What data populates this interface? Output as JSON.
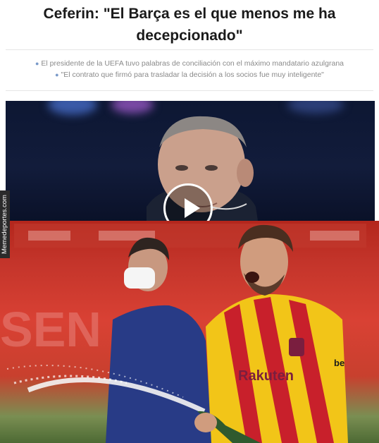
{
  "article": {
    "headline": "Ceferin: \"El Barça es el que menos me ha decepcionado\"",
    "bullets": [
      "El presidente de la UEFA tuvo palabras de conciliación con el máximo mandatario azulgrana",
      "\"El contrato que firmó para trasladar la decisión a los socios fue muy inteligente\""
    ]
  },
  "video": {
    "play_icon": "play-icon"
  },
  "meme": {
    "watermark": "Memedeportes.com",
    "jersey_sponsor": "Rakuten",
    "sleeve_text": "be",
    "board_text": "SEN"
  },
  "colors": {
    "jersey_yellow": "#f2c518",
    "jersey_red": "#c8202b",
    "ucl_navy": "#0d1733",
    "stadium_red": "#cf3a2f",
    "bullet_gray": "#8a8a8a"
  }
}
